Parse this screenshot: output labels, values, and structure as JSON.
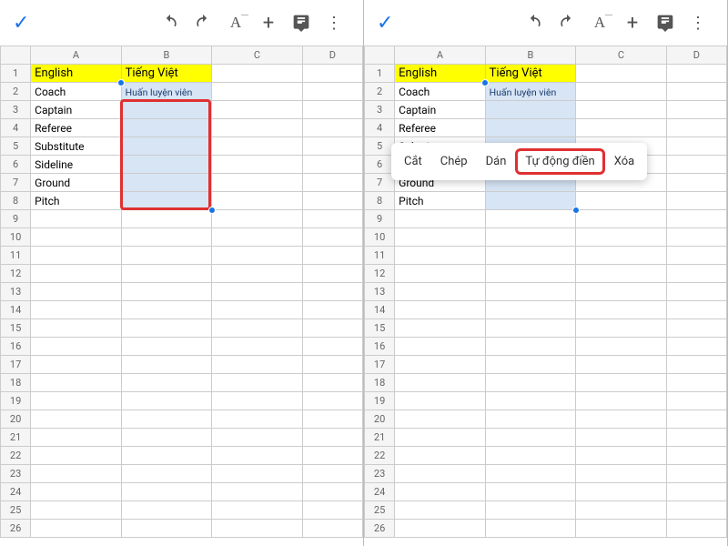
{
  "toolbar": {
    "check": "✓",
    "undo": "undo",
    "redo": "redo",
    "textformat": "A",
    "plus": "+",
    "comment": "comment",
    "more": "⋮"
  },
  "columns": [
    "A",
    "B",
    "C",
    "D"
  ],
  "rows_total": 26,
  "headers": {
    "A": "English",
    "B": "Tiếng Việt"
  },
  "colA": {
    "2": "Coach",
    "3": "Captain",
    "4": "Referee",
    "5": "Substitute",
    "6": "Sideline",
    "7": "Ground",
    "8": "Pitch"
  },
  "colB": {
    "2": "Huấn luyện viên"
  },
  "selection": {
    "col": "B",
    "from": 2,
    "to": 8
  },
  "context_menu": {
    "items": [
      "Cắt",
      "Chép",
      "Dán",
      "Tự động điền",
      "Xóa"
    ],
    "highlight_index": 3
  }
}
